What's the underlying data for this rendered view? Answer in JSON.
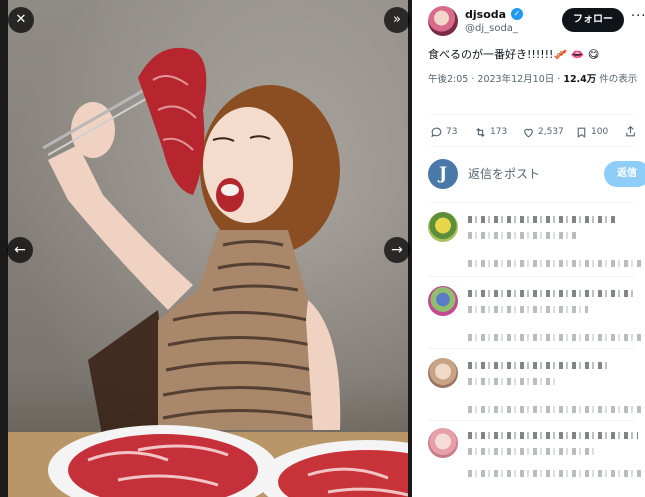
{
  "controls": {
    "close_glyph": "✕",
    "expand_glyph": "»",
    "prev_glyph": "←",
    "next_glyph": "→"
  },
  "author": {
    "name": "djsoda",
    "handle": "@dj_soda_",
    "verified_glyph": "✓",
    "follow_label": "フォロー",
    "more_glyph": "···"
  },
  "tweet": {
    "text": "食べるのが一番好き!!!!!!🥓 👄 😋",
    "time": "午後2:05",
    "separator": " · ",
    "date": "2023年12月10日",
    "views_count": "12.4万",
    "views_label": " 件の表示"
  },
  "actions": {
    "replies": "73",
    "retweets": "173",
    "likes": "2,537",
    "bookmarks": "100"
  },
  "reply_composer": {
    "avatar_letter": "J",
    "placeholder": "返信をポスト",
    "submit_label": "返信"
  },
  "colors": {
    "accent": "#1d9bf0",
    "follow_bg": "#0f1419",
    "reply_btn_bg": "#8ecdf8"
  }
}
